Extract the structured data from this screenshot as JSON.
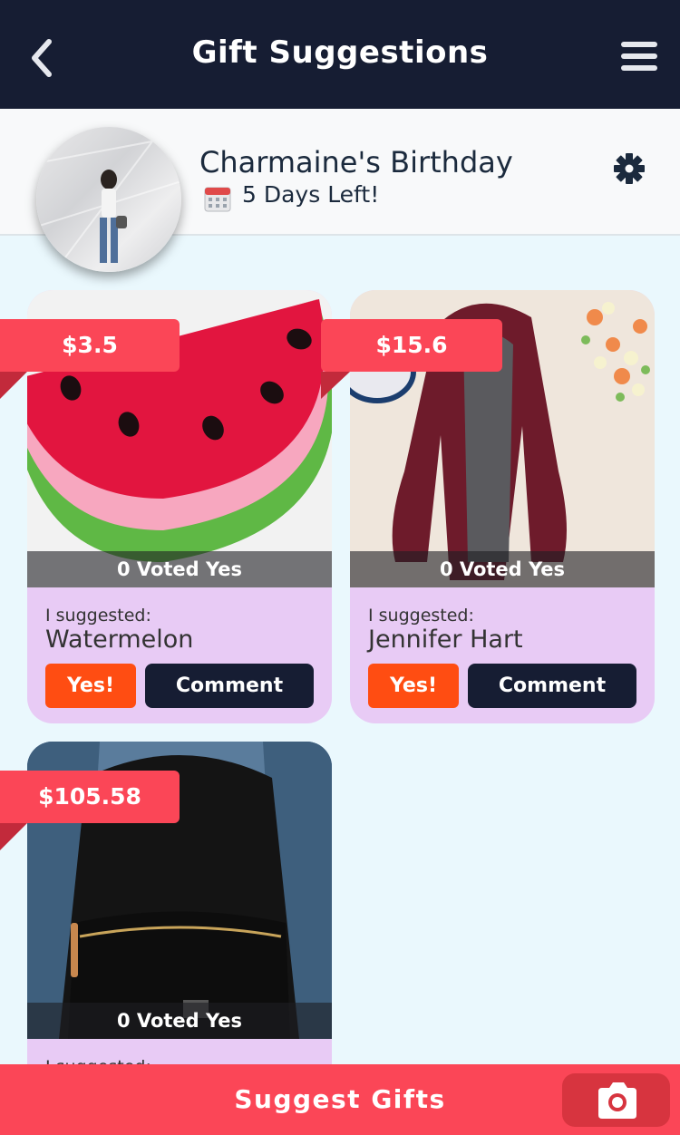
{
  "header": {
    "title": "Gift Suggestions",
    "back_icon": "chevron-left-icon",
    "menu_icon": "hamburger-menu-icon"
  },
  "event": {
    "name": "Charmaine's Birthday",
    "days_left": "5 Days Left!",
    "calendar_icon": "calendar-icon",
    "settings_icon": "gear-icon"
  },
  "gifts": [
    {
      "price": "$3.5",
      "voted": "0 Voted Yes",
      "suggested_label": "I suggested:",
      "name": "Watermelon",
      "yes_label": "Yes!",
      "comment_label": "Comment"
    },
    {
      "price": "$15.6",
      "voted": "0 Voted Yes",
      "suggested_label": "I suggested:",
      "name": "Jennifer Hart",
      "yes_label": "Yes!",
      "comment_label": "Comment"
    },
    {
      "price": "$105.58",
      "voted": "0 Voted Yes",
      "suggested_label": "I suggested:",
      "name": "",
      "yes_label": "",
      "comment_label": ""
    }
  ],
  "footer": {
    "suggest_label": "Suggest Gifts",
    "camera_icon": "camera-icon"
  },
  "colors": {
    "header_bg": "#161d33",
    "accent": "#fb4657",
    "yes": "#ff4d12",
    "card_bg": "#e8cbf5",
    "page_bg": "#eaf8fd"
  }
}
